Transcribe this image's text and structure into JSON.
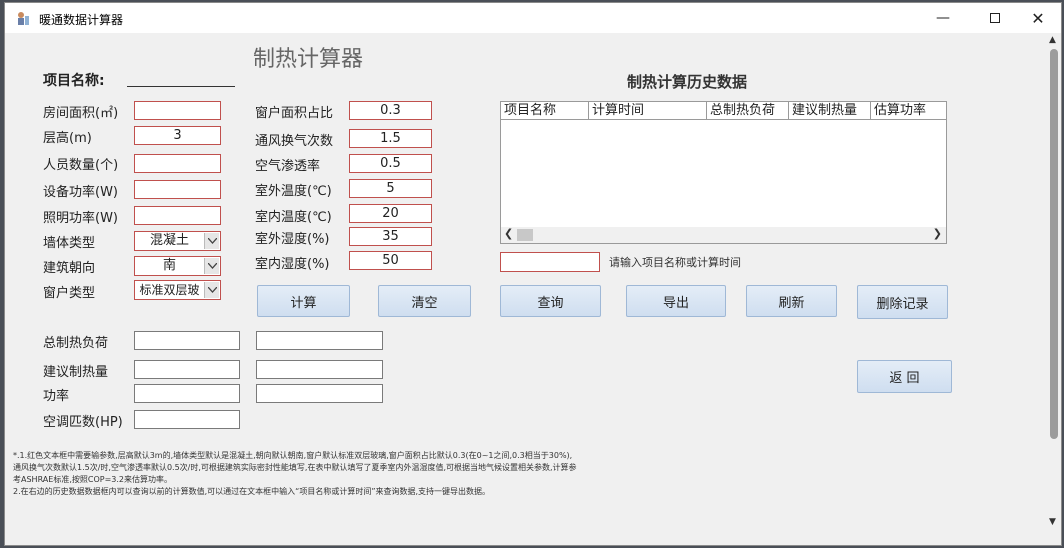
{
  "window": {
    "title": "暖通数据计算器",
    "min_icon": "minimize-icon",
    "max_icon": "maximize-icon",
    "close_icon": "close-icon"
  },
  "heading": "制热计算器",
  "project_label": "项目名称:",
  "left_fields": [
    {
      "label": "房间面积(㎡)",
      "value": ""
    },
    {
      "label": "层高(m)",
      "value": "3"
    },
    {
      "label": "人员数量(个)",
      "value": ""
    },
    {
      "label": "设备功率(W)",
      "value": ""
    },
    {
      "label": "照明功率(W)",
      "value": ""
    }
  ],
  "combos": [
    {
      "label": "墙体类型",
      "value": "混凝土"
    },
    {
      "label": "建筑朝向",
      "value": "南"
    },
    {
      "label": "窗户类型",
      "value": "标准双层玻"
    }
  ],
  "mid_fields": [
    {
      "label": "窗户面积占比",
      "value": "0.3"
    },
    {
      "label": "通风换气次数",
      "value": "1.5"
    },
    {
      "label": "空气渗透率",
      "value": "0.5"
    },
    {
      "label": "室外温度(℃)",
      "value": "5"
    },
    {
      "label": "室内温度(℃)",
      "value": "20"
    },
    {
      "label": "室外湿度(%)",
      "value": "35"
    },
    {
      "label": "室内湿度(%)",
      "value": "50"
    }
  ],
  "history_title": "制热计算历史数据",
  "columns": [
    "项目名称",
    "计算时间",
    "总制热负荷",
    "建议制热量",
    "估算功率"
  ],
  "search_hint": "请输入项目名称或计算时间",
  "buttons": {
    "calc": "计算",
    "clear": "清空",
    "query": "查询",
    "export": "导出",
    "refresh": "刷新",
    "delete": "删除记录",
    "back": "返 回"
  },
  "results": [
    "总制热负荷",
    "建议制热量",
    "功率",
    "空调匹数(HP)"
  ],
  "notes": [
    "*.1.红色文本框中需要输参数,层高默认3m的,墙体类型默认是混凝土,朝向默认朝南,窗户默认标准双层玻璃,窗户面积占比默认0.3(在0~1之间,0.3相当于30%),",
    "通风换气次数默认1.5次/时,空气渗透率默认0.5次/时,可根据建筑实际密封性能填写,在表中默认填写了夏季室内外温湿度值,可根据当地气候设置相关参数,计算参",
    "考ASHRAE标准,按照COP=3.2来估算功率。",
    "2.在右边的历史数据数据框内可以查询以前的计算数值,可以通过在文本框中输入“项目名称或计算时间”来查询数据,支持一键导出数据。"
  ]
}
